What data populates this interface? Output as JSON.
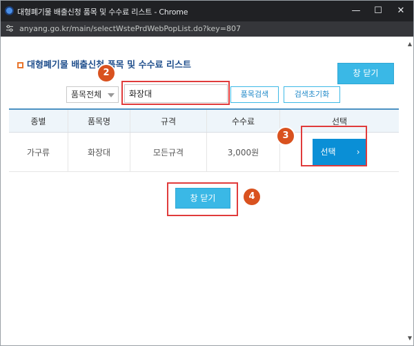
{
  "window": {
    "title": "대형폐기물 배출신청 품목 및 수수료 리스트 - Chrome",
    "url": "anyang.go.kr/main/selectWstePrdWebPopList.do?key=807",
    "controls": {
      "minimize": "—",
      "maximize": "☐",
      "close": "✕"
    }
  },
  "popup": {
    "title": "대형폐기물 배출신청 품목 및 수수료 리스트",
    "close_top_label": "창 닫기",
    "close_bottom_label": "창 닫기"
  },
  "search": {
    "category_selected": "품목전체",
    "query_value": "화장대",
    "search_button": "품목검색",
    "reset_button": "검색초기화"
  },
  "table": {
    "headers": [
      "종별",
      "품목명",
      "규격",
      "수수료",
      "선택"
    ],
    "rows": [
      {
        "type": "가구류",
        "name": "화장대",
        "spec": "모든규격",
        "fee": "3,000원",
        "select_label": "선택",
        "select_arrow": "›"
      }
    ]
  },
  "annotations": {
    "step2": "2",
    "step3": "3",
    "step4": "4"
  },
  "colors": {
    "accent": "#3ab8e6",
    "select_button": "#0a8fd6",
    "highlight": "#e03a3a",
    "badge": "#d9521f"
  }
}
